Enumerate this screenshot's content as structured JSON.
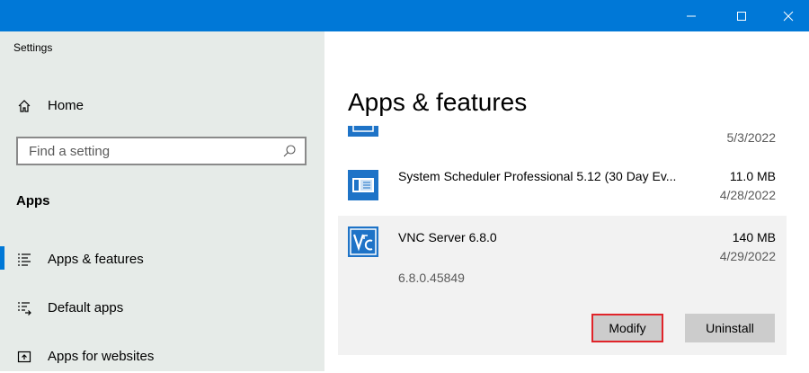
{
  "window": {
    "title": "Settings",
    "controls": [
      "minimize",
      "maximize",
      "close"
    ]
  },
  "colors": {
    "accent": "#0078d7",
    "sidebar_bg": "#e6ebe8",
    "selected_row_bg": "#f2f2f2",
    "highlight_border": "#e0242a"
  },
  "sidebar": {
    "home_label": "Home",
    "search_placeholder": "Find a setting",
    "section_heading": "Apps",
    "items": [
      {
        "label": "Apps & features",
        "icon": "apps-list-icon",
        "active": true
      },
      {
        "label": "Default apps",
        "icon": "default-apps-icon",
        "active": false
      },
      {
        "label": "Apps for websites",
        "icon": "apps-for-websites-icon",
        "active": false
      }
    ]
  },
  "main": {
    "title": "Apps & features",
    "apps": [
      {
        "name": "",
        "size": "",
        "date": "5/3/2022",
        "icon": "app-icon"
      },
      {
        "name": "System Scheduler Professional 5.12 (30 Day Ev...",
        "size": "11.0 MB",
        "date": "4/28/2022",
        "icon": "scheduler-app-icon"
      },
      {
        "name": "VNC Server 6.8.0",
        "size": "140 MB",
        "date": "4/29/2022",
        "version": "6.8.0.45849",
        "icon": "vnc-app-icon",
        "buttons": {
          "modify": "Modify",
          "uninstall": "Uninstall"
        }
      }
    ]
  }
}
